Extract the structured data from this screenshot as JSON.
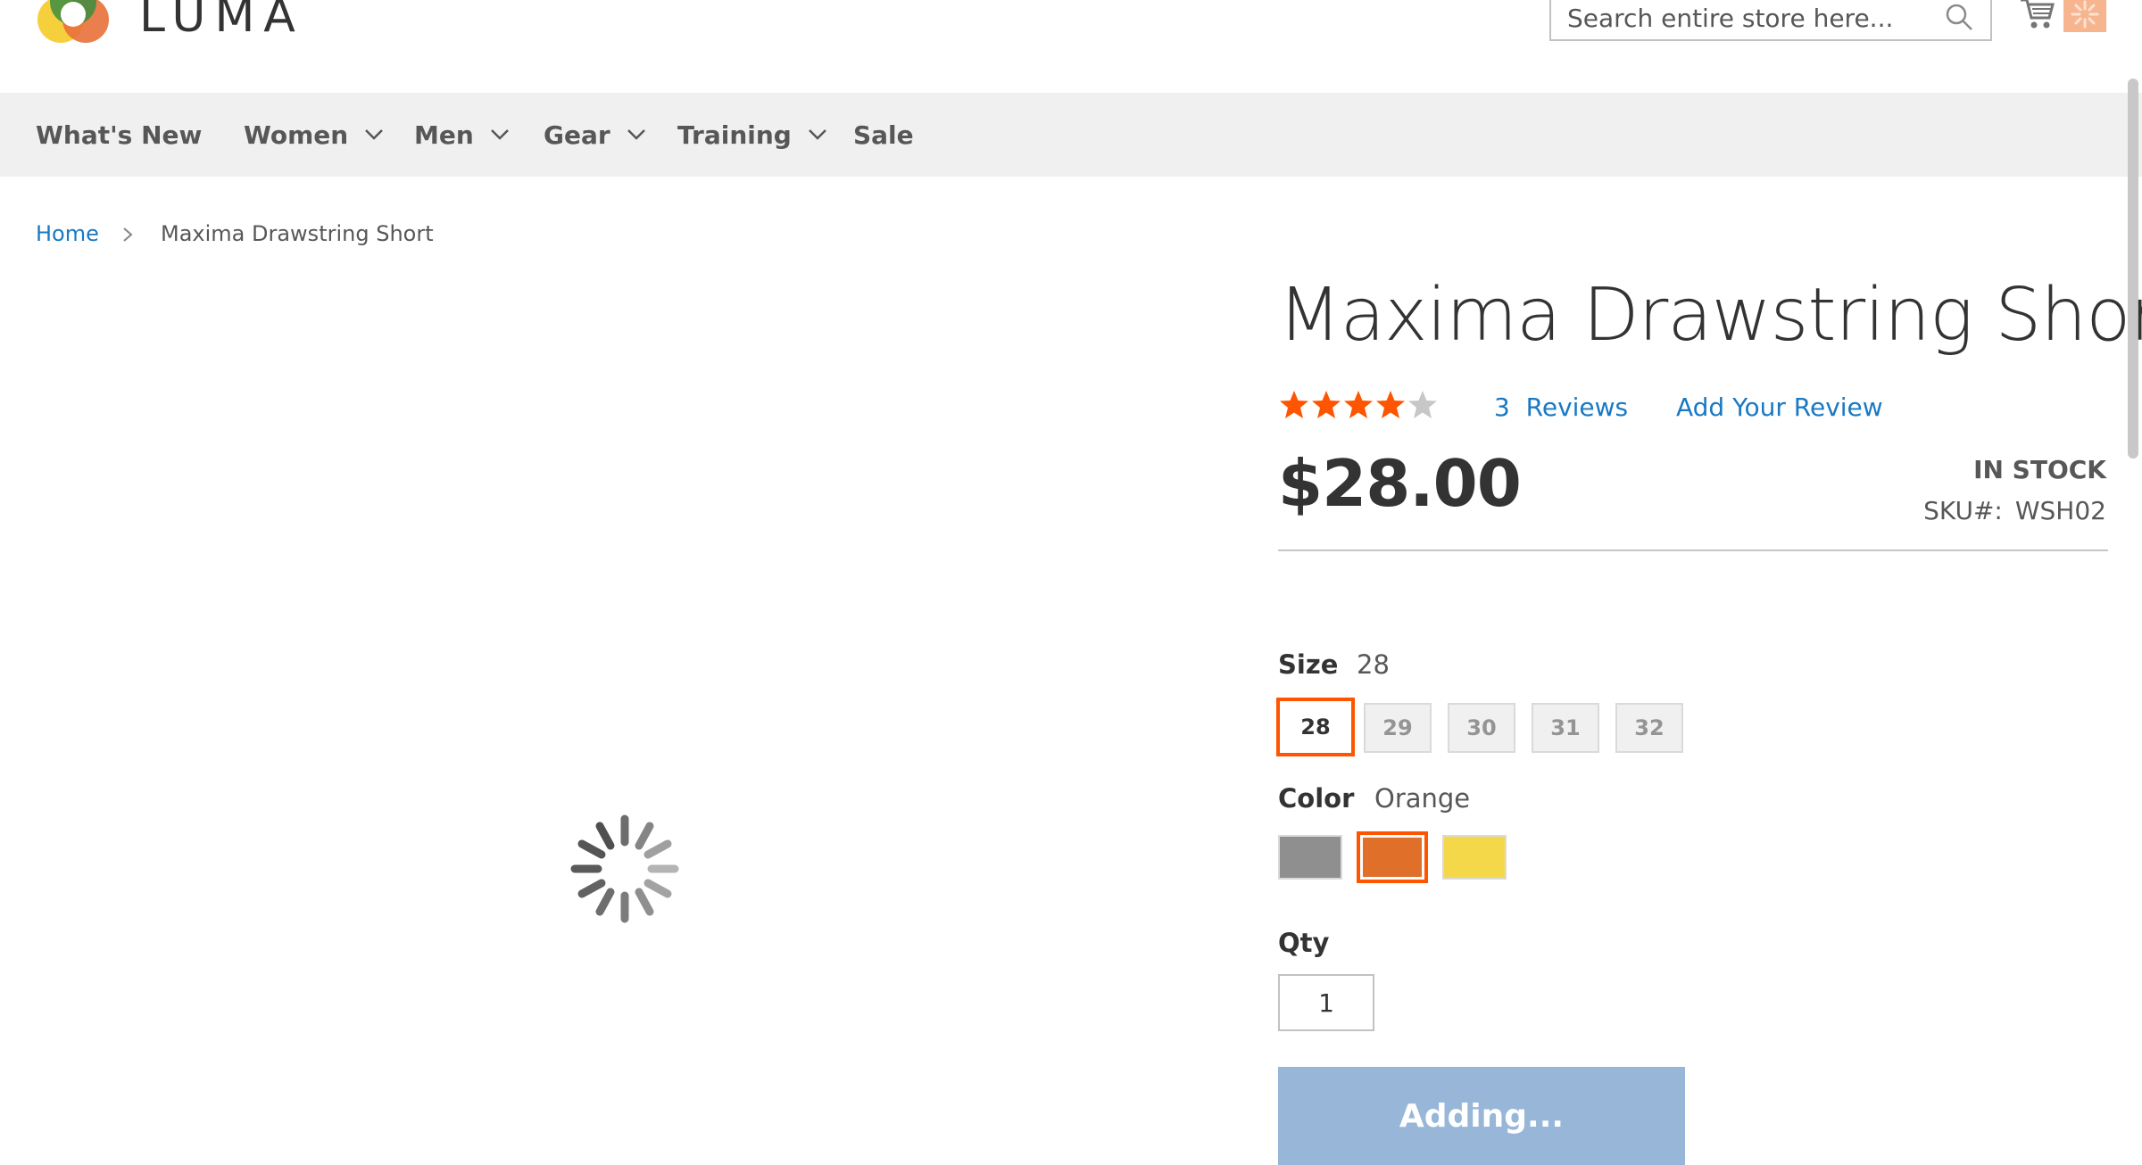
{
  "header": {
    "logo_text": "LUMA",
    "search_placeholder": "Search entire store here...",
    "icons": [
      "luma-logo-icon",
      "search-icon",
      "cart-icon"
    ]
  },
  "nav": {
    "items": [
      {
        "label": "What's New",
        "has_dropdown": false
      },
      {
        "label": "Women",
        "has_dropdown": true
      },
      {
        "label": "Men",
        "has_dropdown": true
      },
      {
        "label": "Gear",
        "has_dropdown": true
      },
      {
        "label": "Training",
        "has_dropdown": true
      },
      {
        "label": "Sale",
        "has_dropdown": false
      }
    ]
  },
  "breadcrumb": {
    "home": "Home",
    "current": "Maxima Drawstring Short"
  },
  "product": {
    "title": "Maxima Drawstring Short",
    "rating": {
      "value": 4,
      "max": 5
    },
    "reviews_count": "3",
    "reviews_label": "Reviews",
    "add_review_label": "Add Your Review",
    "price": "$28.00",
    "stock": "IN STOCK",
    "sku_label": "SKU#:",
    "sku": "WSH02",
    "size": {
      "label": "Size",
      "selected": "28",
      "options": [
        "28",
        "29",
        "30",
        "31",
        "32"
      ]
    },
    "color": {
      "label": "Color",
      "selected": "Orange",
      "options": [
        {
          "name": "Gray",
          "hex": "#8f8f8f"
        },
        {
          "name": "Orange",
          "hex": "#e07029"
        },
        {
          "name": "Yellow",
          "hex": "#f5d84a"
        }
      ]
    },
    "qty": {
      "label": "Qty",
      "value": "1"
    },
    "add_button_label": "Adding..."
  },
  "colors": {
    "accent_orange": "#ff5501",
    "link_blue": "#1979c3",
    "button_disabled_blue": "#97b6d8",
    "nav_bg": "#f0f0f0"
  }
}
